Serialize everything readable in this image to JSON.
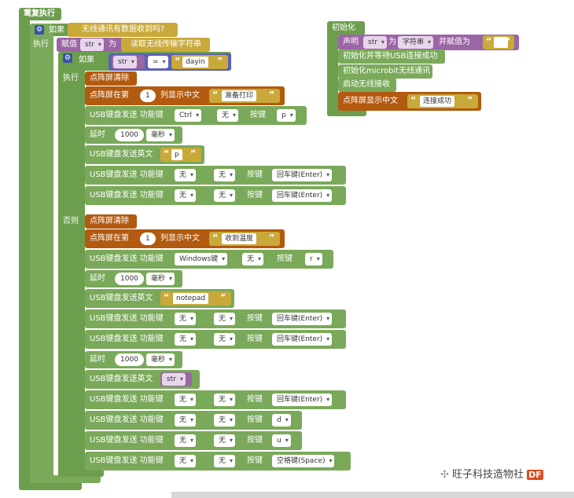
{
  "loop": {
    "label": "重复执行"
  },
  "outer_if": {
    "if_label": "如果",
    "cond": "无线通讯有数据收到吗?",
    "do_label": "执行"
  },
  "assign": {
    "label": "赋值",
    "var": "str",
    "as_label": "为",
    "value": "读取无线传输字符串"
  },
  "inner_if": {
    "if_label": "如果",
    "var": "str",
    "op": "=",
    "str_value": "dayin",
    "do_label": "执行",
    "else_label": "否则"
  },
  "blocks": {
    "led_clear": "点阵屏清除",
    "led_row_pre": "点阵屏在第",
    "led_row_mid": "列显示中文",
    "usb_key": "USB键盘发送 功能键",
    "key_label": "按键",
    "delay": "延时",
    "ms": "毫秒",
    "usb_text": "USB键盘发送英文"
  },
  "then_branch": {
    "row1_num": "1",
    "row1_text": "准备打印",
    "key1": {
      "mod1": "Ctrl",
      "mod2": "无",
      "key": "p"
    },
    "delay1": "1000",
    "text1": "p",
    "key2": {
      "mod1": "无",
      "mod2": "无",
      "key": "回车键(Enter)"
    },
    "key3": {
      "mod1": "无",
      "mod2": "无",
      "key": "回车键(Enter)"
    }
  },
  "else_branch": {
    "row_num": "1",
    "row_text": "收到温度",
    "key1": {
      "mod1": "Windows键",
      "mod2": "无",
      "key": "r"
    },
    "delay1": "1000",
    "text1": "notepad",
    "key2": {
      "mod1": "无",
      "mod2": "无",
      "key": "回车键(Enter)"
    },
    "key3": {
      "mod1": "无",
      "mod2": "无",
      "key": "回车键(Enter)"
    },
    "delay2": "1000",
    "text2_var": "str",
    "key4": {
      "mod1": "无",
      "mod2": "无",
      "key": "回车键(Enter)"
    },
    "key5": {
      "mod1": "无",
      "mod2": "无",
      "key": "d"
    },
    "key6": {
      "mod1": "无",
      "mod2": "无",
      "key": "u"
    },
    "key7": {
      "mod1": "无",
      "mod2": "无",
      "key": "空格键(Space)"
    }
  },
  "init": {
    "label": "初始化",
    "declare_label": "声明",
    "declare_var": "str",
    "declare_as": "为",
    "declare_type": "字符串",
    "declare_assign": "并赋值为",
    "usb_init": "初始化并等待USB连接成功",
    "radio_init": "初始化microbit无线通讯",
    "radio_start": "启动无线接收",
    "led_text_label": "点阵屏显示中文",
    "led_text": "连接成功"
  },
  "watermark": {
    "text": "旺子科技造物社",
    "badge": "DF"
  },
  "colors": {
    "loop": "#6d9e4e",
    "variable": "#9b66a5",
    "led": "#b25a10",
    "text": "#c9a93a",
    "logic": "#5a62b5"
  }
}
